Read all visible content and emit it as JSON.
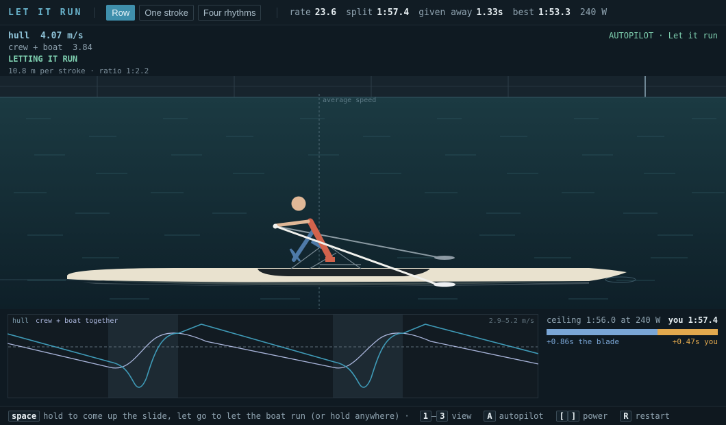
{
  "app": {
    "title": "LET IT RUN"
  },
  "tabs": [
    {
      "label": "Row",
      "active": true
    },
    {
      "label": "One stroke",
      "active": false
    },
    {
      "label": "Four rhythms",
      "active": false
    }
  ],
  "stats": {
    "rate_label": "rate",
    "rate": "23.6",
    "split_label": "split",
    "split": "1:57.4",
    "given_label": "given away",
    "given": "1.33s",
    "best_label": "best",
    "best": "1:53.3",
    "power": "240 W"
  },
  "hud": {
    "hull_label": "hull",
    "hull_value": "4.07 m/s",
    "crew_label": "crew + boat",
    "crew_value": "3.84",
    "status": "LETTING IT RUN",
    "stroke_info": "10.8 m per stroke · ratio 1:2.2"
  },
  "autopilot": "AUTOPILOT · Let it run",
  "scene": {
    "avg_label": "average speed"
  },
  "graph": {
    "legend_hull": "hull",
    "legend_crew": "crew + boat together",
    "range": "2.9–5.2 m/s",
    "colors": {
      "hull": "#3f9bb8",
      "crew": "#aab6dc",
      "drive_band": "#1d2a33"
    }
  },
  "panel": {
    "ceiling": "ceiling 1:56.0 at 240 W",
    "you": "you 1:57.4",
    "blade_text": "+0.86s the blade",
    "you_text": "+0.47s you",
    "blade_seconds": 0.86,
    "you_seconds": 0.47
  },
  "footer": {
    "space_key": "space",
    "space_text": "hold to come up the slide, let go to let the boat run  (or hold anywhere) ·",
    "view_key1": "1",
    "view_dash": "–",
    "view_key2": "3",
    "view_text": "view",
    "a_key": "A",
    "a_text": "autopilot",
    "power_key1": "[",
    "power_key2": "]",
    "power_text": "power",
    "r_key": "R",
    "r_text": "restart"
  }
}
